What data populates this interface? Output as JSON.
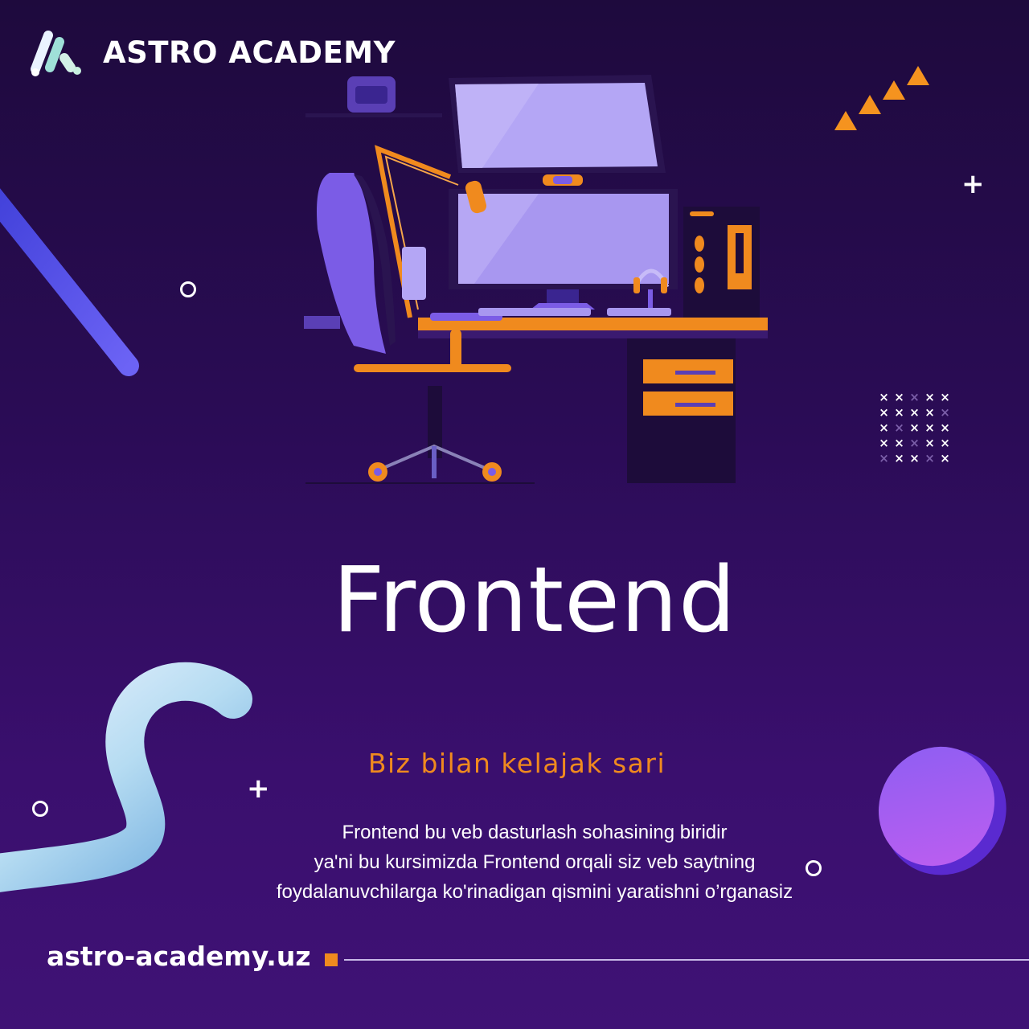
{
  "brand": {
    "name": "ASTRO ACADEMY",
    "logo_icon": "astro-academy-logo-mark"
  },
  "illustration": {
    "subject": "workstation-illustration",
    "icons": [
      "monitor-icon",
      "microphone-icon",
      "headphones-icon",
      "gaming-chair-icon",
      "desk-icon",
      "pc-tower-icon",
      "webcam-icon"
    ]
  },
  "headline": "Frontend",
  "tagline": "Biz bilan kelajak sari",
  "description": {
    "lines": [
      "Frontend bu veb dasturlash sohasining biridir",
      "ya'ni bu kursimizda Frontend orqali siz veb saytning",
      "foydalanuvchilarga ko'rinadigan qismini yaratishni o’rganasiz"
    ]
  },
  "footer": {
    "website": "astro-academy.uz"
  },
  "colors": {
    "background_top": "#1e0a3d",
    "background_bottom": "#3f1275",
    "accent_orange": "#f08a1e",
    "illustration_lavender": "#a897f0",
    "illustration_purple": "#7b5ce6",
    "text_white": "#ffffff",
    "blob_cyan": "#9ad2ea",
    "disc_violet": "#9a5cf0"
  }
}
